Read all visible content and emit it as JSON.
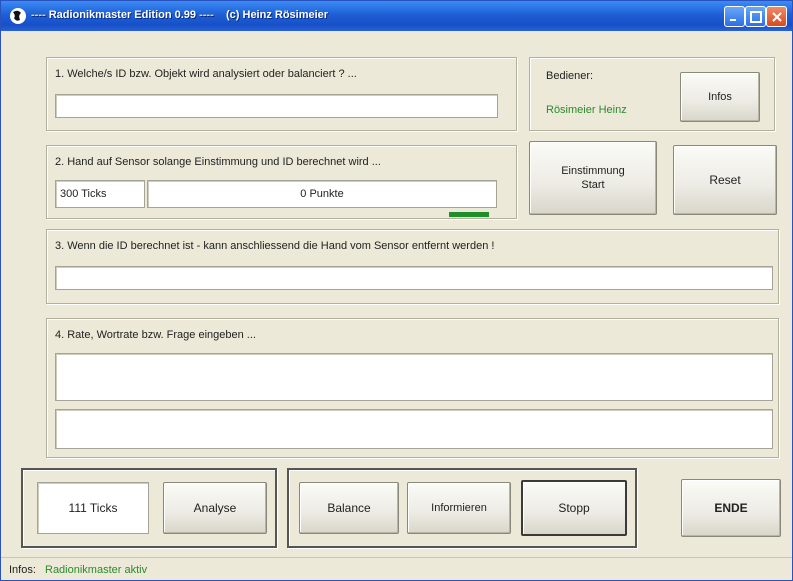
{
  "window": {
    "title_prefix": "----",
    "title_main": "Radionikmaster Edition 0.99",
    "title_sep": "----",
    "title_credit": "(c) Heinz Rösimeier"
  },
  "section1": {
    "label": "1. Welche/s ID bzw. Objekt wird analysiert oder balanciert ? ...",
    "input_value": ""
  },
  "operator": {
    "label": "Bediener:",
    "name": "Rösimeier Heinz",
    "infos_button": "Infos"
  },
  "section2": {
    "label": "2. Hand auf Sensor solange Einstimmung und ID berechnet wird ...",
    "ticks_label": "300 Ticks",
    "points_label": "0 Punkte",
    "progress": 0.1
  },
  "tuning_button": {
    "line1": "Einstimmung",
    "line2": "Start"
  },
  "reset_button": "Reset",
  "section3": {
    "label": "3. Wenn die ID berechnet ist - kann anschliessend  die Hand vom Sensor entfernt werden !",
    "input_value": ""
  },
  "section4": {
    "label": "4. Rate, Wortrate bzw. Frage eingeben ...",
    "input1_value": "",
    "input2_value": ""
  },
  "controls": {
    "ticks_value": "111 Ticks",
    "analyse_button": "Analyse",
    "balance_button": "Balance",
    "informieren_button": "Informieren",
    "stopp_button": "Stopp",
    "ende_button": "ENDE"
  },
  "status": {
    "label": "Infos:",
    "value": "Radionikmaster aktiv"
  },
  "colors": {
    "titlebar": "#1f5fd6",
    "progress": "#1f8f2a",
    "status_text": "#2b8a2b"
  }
}
